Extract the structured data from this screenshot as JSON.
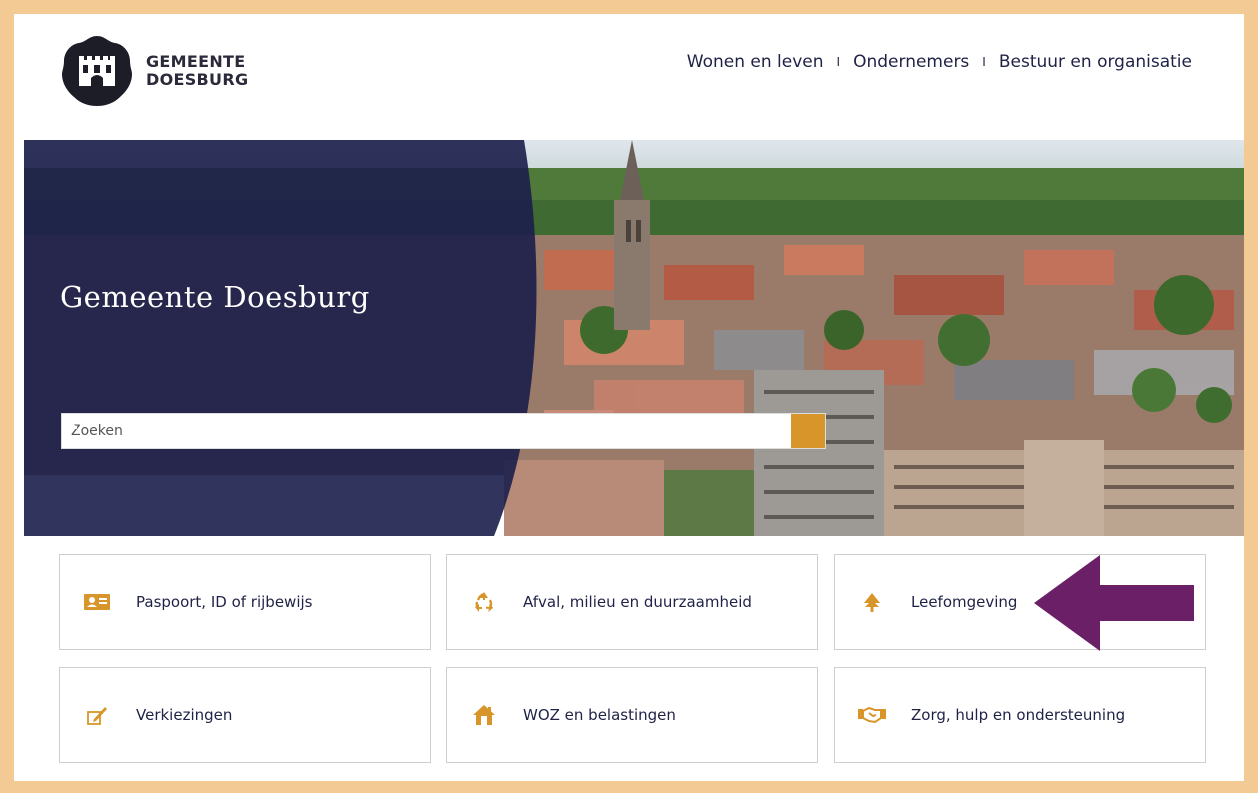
{
  "brand": {
    "line1": "GEMEENTE",
    "line2": "DOESBURG"
  },
  "nav": {
    "items": [
      "Wonen en leven",
      "Ondernemers",
      "Bestuur en organisatie"
    ],
    "separator": "I"
  },
  "hero": {
    "title": "Gemeente Doesburg"
  },
  "search": {
    "placeholder": "Zoeken"
  },
  "tiles": [
    {
      "label": "Paspoort, ID of rijbewijs",
      "icon": "id-card-icon"
    },
    {
      "label": "Afval, milieu en duurzaamheid",
      "icon": "recycle-icon"
    },
    {
      "label": "Leefomgeving",
      "icon": "tree-icon"
    },
    {
      "label": "Verkiezingen",
      "icon": "ballot-pencil-icon"
    },
    {
      "label": "WOZ en belastingen",
      "icon": "house-icon"
    },
    {
      "label": "Zorg, hulp en ondersteuning",
      "icon": "handshake-icon"
    }
  ],
  "colors": {
    "frame": "#f3c994",
    "navy": "#1f2247",
    "accent": "#d8962a",
    "arrow": "#6b1f66"
  }
}
